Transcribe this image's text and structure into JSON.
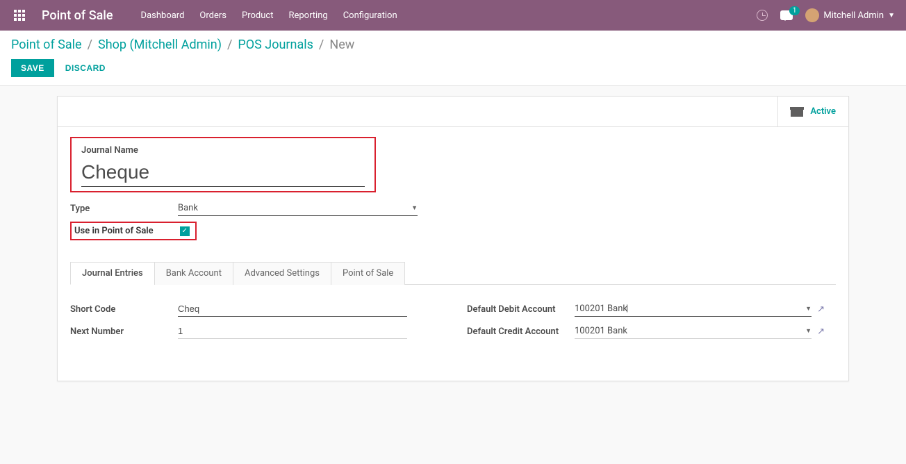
{
  "brand": "Point of Sale",
  "nav": {
    "items": [
      "Dashboard",
      "Orders",
      "Product",
      "Reporting",
      "Configuration"
    ],
    "chat_count": "1",
    "user_name": "Mitchell Admin"
  },
  "breadcrumb": {
    "root": "Point of Sale",
    "shop": "Shop (Mitchell Admin)",
    "journals": "POS Journals",
    "current": "New"
  },
  "buttons": {
    "save": "SAVE",
    "discard": "DISCARD"
  },
  "status": {
    "active": "Active"
  },
  "form": {
    "journal_name_label": "Journal Name",
    "journal_name_value": "Cheque",
    "type_label": "Type",
    "type_value": "Bank",
    "use_pos_label": "Use in Point of Sale"
  },
  "tabs": {
    "journal_entries": "Journal Entries",
    "bank_account": "Bank Account",
    "advanced_settings": "Advanced Settings",
    "point_of_sale": "Point of Sale"
  },
  "entries": {
    "short_code_label": "Short Code",
    "short_code_value": "Cheq",
    "next_number_label": "Next Number",
    "next_number_value": "1",
    "debit_label": "Default Debit Account",
    "debit_value": "100201 Bank",
    "credit_label": "Default Credit Account",
    "credit_value": "100201 Bank"
  }
}
